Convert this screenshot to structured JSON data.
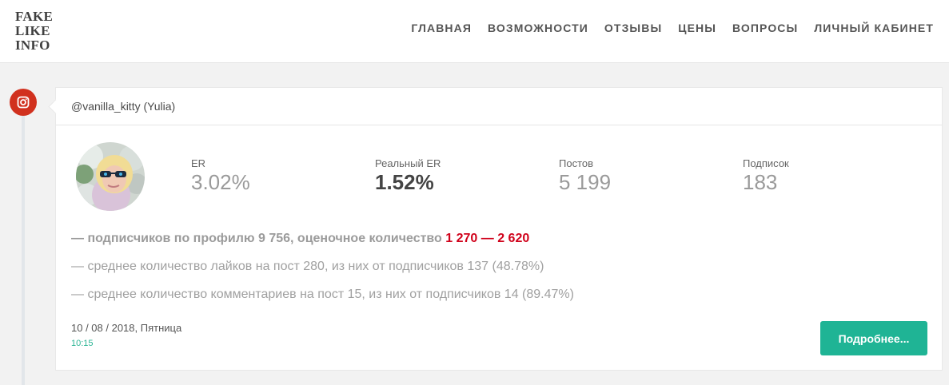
{
  "logo": {
    "lines": [
      "FAKE",
      "LIKE",
      "INFO"
    ]
  },
  "nav": [
    "ГЛАВНАЯ",
    "ВОЗМОЖНОСТИ",
    "ОТЗЫВЫ",
    "ЦЕНЫ",
    "ВОПРОСЫ",
    "ЛИЧНЫЙ КАБИНЕТ"
  ],
  "platform_icon": "instagram-icon",
  "card": {
    "username": "@vanilla_kitty (Yulia)",
    "stats": [
      {
        "label": "ER",
        "value": "3.02%"
      },
      {
        "label": "Реальный ER",
        "value": "1.52%"
      },
      {
        "label": "Постов",
        "value": "5 199"
      },
      {
        "label": "Подписок",
        "value": "183"
      }
    ],
    "followers_prefix": "— подписчиков по профилю 9 756, оценочное количество ",
    "followers_estimate": "1 270 — 2 620",
    "likes_line": "— среднее количество лайков на пост 280, из них от подписчиков 137 (48.78%)",
    "comments_line": "— среднее количество комментариев на пост 15, из них от подписчиков 14 (89.47%)",
    "date": "10 / 08 / 2018, Пятница",
    "time": "10:15",
    "details_button": "Подробнее..."
  },
  "colors": {
    "accent_green": "#1fb495",
    "highlight_red": "#d0021b",
    "instagram_badge": "#d1311e"
  }
}
